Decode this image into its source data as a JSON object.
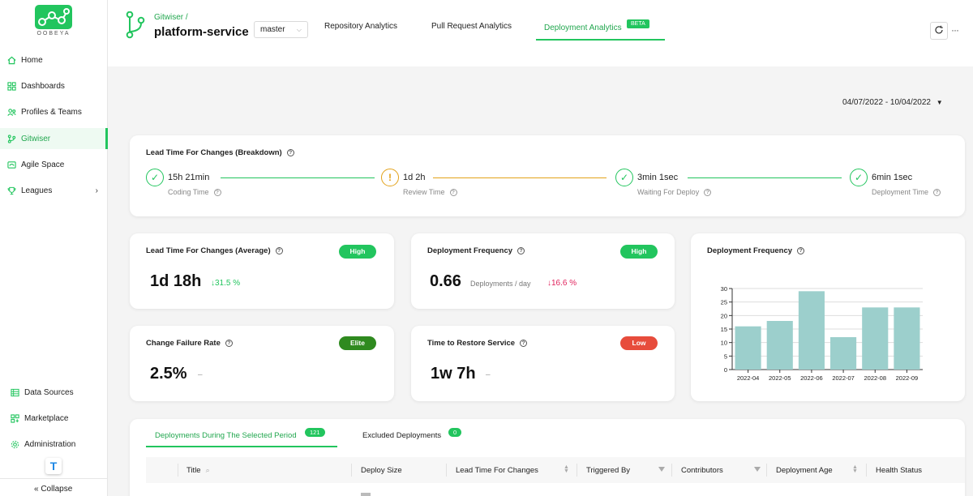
{
  "sidebar": {
    "logo_text": "OOBEYA",
    "items": [
      {
        "label": "Home"
      },
      {
        "label": "Dashboards"
      },
      {
        "label": "Profiles & Teams"
      },
      {
        "label": "Gitwiser"
      },
      {
        "label": "Agile Space"
      },
      {
        "label": "Leagues"
      }
    ],
    "bottom_items": [
      {
        "label": "Data Sources"
      },
      {
        "label": "Marketplace"
      },
      {
        "label": "Administration"
      }
    ],
    "user_initial": "T",
    "collapse_label": "« Collapse"
  },
  "header": {
    "breadcrumb": "Gitwiser /",
    "repo_name": "platform-service",
    "branch": "master",
    "tabs": [
      {
        "label": "Repository Analytics"
      },
      {
        "label": "Pull Request Analytics"
      },
      {
        "label": "Deployment Analytics"
      }
    ],
    "beta_label": "BETA"
  },
  "date_range": "04/07/2022 - 10/04/2022",
  "breakdown": {
    "title": "Lead Time For Changes (Breakdown)",
    "steps": [
      {
        "value": "15h 21min",
        "label": "Coding Time",
        "status": "ok"
      },
      {
        "value": "1d 2h",
        "label": "Review Time",
        "status": "warn"
      },
      {
        "value": "3min 1sec",
        "label": "Waiting For Deploy",
        "status": "ok"
      },
      {
        "value": "6min 1sec",
        "label": "Deployment Time",
        "status": "ok"
      }
    ]
  },
  "metrics": {
    "lead_time": {
      "title": "Lead Time For Changes (Average)",
      "badge": "High",
      "value": "1d 18h",
      "delta": "↓31.5 %"
    },
    "deploy_freq": {
      "title": "Deployment Frequency",
      "badge": "High",
      "value": "0.66",
      "unit": "Deployments / day",
      "delta": "↓16.6 %"
    },
    "cfr": {
      "title": "Change Failure Rate",
      "badge": "Elite",
      "value": "2.5%",
      "delta": "–"
    },
    "mttr": {
      "title": "Time to Restore Service",
      "badge": "Low",
      "value": "1w 7h",
      "delta": "–"
    }
  },
  "colors": {
    "brand": "#22c55e",
    "high": "#22c55e",
    "elite": "#2f8a1f",
    "low": "#e74c3c",
    "positive_delta": "#22c55e",
    "negative_delta": "#e0245e",
    "warn": "#e3a21a",
    "bar": "#9ccfcc"
  },
  "chart_data": {
    "type": "bar",
    "title": "Deployment Frequency",
    "categories": [
      "2022-04",
      "2022-05",
      "2022-06",
      "2022-07",
      "2022-08",
      "2022-09"
    ],
    "values": [
      16,
      18,
      29,
      12,
      23,
      23
    ],
    "ylim": [
      0,
      30
    ],
    "yticks": [
      0,
      5,
      10,
      15,
      20,
      25,
      30
    ],
    "grid": true
  },
  "deployments": {
    "tabs": [
      {
        "label": "Deployments During The Selected Period",
        "count": "121"
      },
      {
        "label": "Excluded Deployments",
        "count": "0"
      }
    ],
    "columns": [
      "Title",
      "Deploy Size",
      "Lead Time For Changes",
      "Triggered By",
      "Contributors",
      "Deployment Age",
      "Health Status"
    ]
  }
}
